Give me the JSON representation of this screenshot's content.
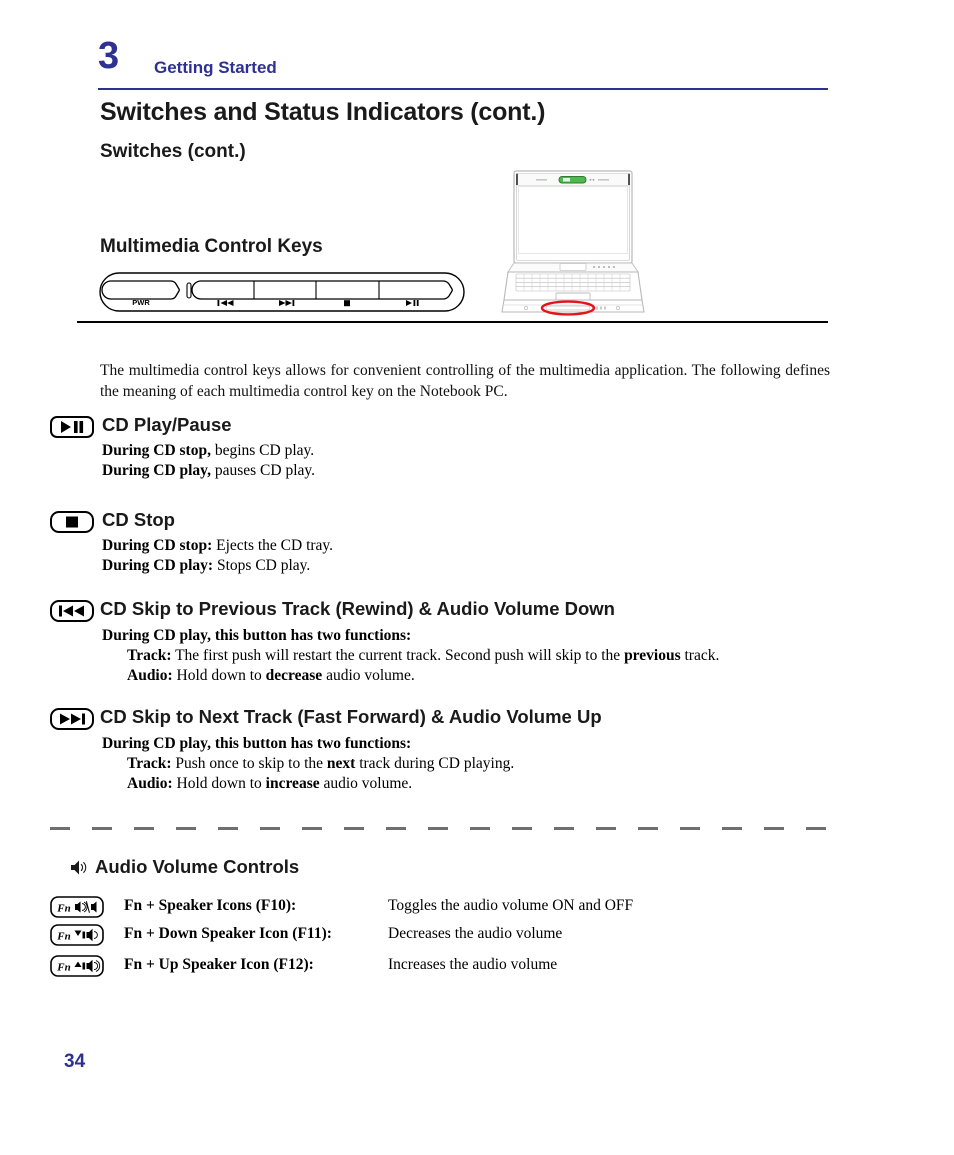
{
  "header": {
    "chapter_number": "3",
    "chapter_title": "Getting Started"
  },
  "titles": {
    "page_title": "Switches and Status Indicators (cont.)",
    "page_subtitle": "Switches (cont.)"
  },
  "figure": {
    "multimedia_heading": "Multimedia Control Keys",
    "control_bar_labels": {
      "power": "PWR",
      "prev": "prev-track-icon",
      "next": "next-track-icon",
      "stop": "stop-icon",
      "play_pause": "play-pause-icon"
    },
    "laptop_alt": "notebook-pc-front-illustration",
    "highlight_color": "#e8121a"
  },
  "intro": "The multimedia control keys allows for convenient controlling of the multimedia application. The following defines the meaning of each multimedia control key on the Notebook PC.",
  "sections": [
    {
      "id": "play",
      "icon": "play-pause-icon",
      "title": "CD Play/Pause",
      "lines": [
        {
          "bold": "During CD stop,",
          "rest": " begins CD play.",
          "indent": false
        },
        {
          "bold": "During CD play,",
          "rest": " pauses CD play.",
          "indent": false
        }
      ]
    },
    {
      "id": "stop",
      "icon": "stop-icon",
      "title": "CD Stop",
      "lines": [
        {
          "bold": "During CD stop:",
          "rest": " Ejects the CD tray.",
          "indent": false
        },
        {
          "bold": "During CD play:",
          "rest": " Stops CD play.",
          "indent": false
        }
      ]
    },
    {
      "id": "prev",
      "icon": "prev-track-icon",
      "title": "CD Skip to Previous Track (Rewind) & Audio Volume Down",
      "lines": [
        {
          "bold": "During CD play, this button has two functions:",
          "rest": "",
          "indent": false
        },
        {
          "bold": "Track:",
          "rest": " The first push will restart the current track. Second push will skip to the ",
          "emph": "previous",
          "tail": " track.",
          "indent": true
        },
        {
          "bold": "Audio:",
          "rest": " Hold down to ",
          "emph": "decrease",
          "tail": " audio volume.",
          "indent": true
        }
      ]
    },
    {
      "id": "next",
      "icon": "next-track-icon",
      "title": "CD Skip to Next Track (Fast Forward) & Audio Volume Up",
      "lines": [
        {
          "bold": "During CD play, this button has two functions:",
          "rest": "",
          "indent": false
        },
        {
          "bold": "Track:",
          "rest": " Push once to skip to the ",
          "emph": "next",
          "tail": " track during CD playing.",
          "indent": true
        },
        {
          "bold": "Audio:",
          "rest": " Hold down to ",
          "emph": "increase",
          "tail": " audio volume.",
          "indent": true
        }
      ]
    }
  ],
  "audio_volume": {
    "icon": "speaker-icon",
    "title": "Audio Volume Controls",
    "rows": [
      {
        "key_prefix": "Fn",
        "key_icon": "speaker-toggle-icon",
        "label": "Fn + Speaker Icons (F10):",
        "desc": "Toggles the audio volume ON and OFF"
      },
      {
        "key_prefix": "Fn",
        "key_icon": "speaker-down-icon",
        "label": "Fn + Down Speaker Icon (F11):",
        "desc": "Decreases the audio volume"
      },
      {
        "key_prefix": "Fn",
        "key_icon": "speaker-up-icon",
        "label": "Fn + Up Speaker Icon (F12):",
        "desc": "Increases the audio volume"
      }
    ]
  },
  "footer": {
    "page_number": "34"
  },
  "colors": {
    "accent": "#2e3192",
    "text": "#1a1a1a",
    "highlight": "#e8121a"
  }
}
